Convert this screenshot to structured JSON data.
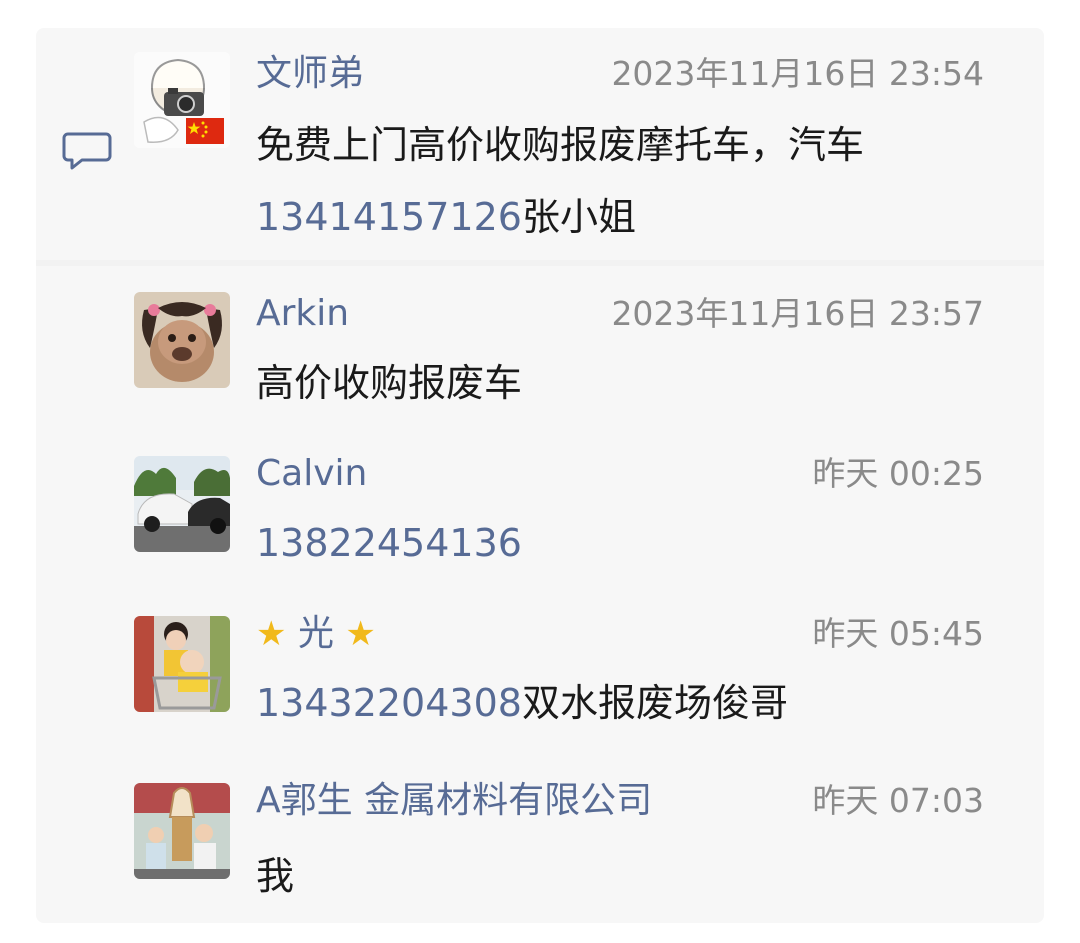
{
  "comments": [
    {
      "name": "文师弟",
      "time": "2023年11月16日 23:54",
      "text_line1": "免费上门高价收购报废摩托车，汽车",
      "phone": "13414157126",
      "text_suffix": "张小姐",
      "avatar": "avatar-chef-with-camera-and-china-flag"
    },
    {
      "name": "Arkin",
      "time": "2023年11月16日 23:57",
      "text": "高价收购报废车",
      "avatar": "avatar-dog-with-pigtails"
    },
    {
      "name": "Calvin",
      "time": "昨天 00:25",
      "phone": "13822454136",
      "avatar": "avatar-white-car"
    },
    {
      "name": "光",
      "name_decoration": "star-emoji",
      "time": "昨天 05:45",
      "phone": "13432204308",
      "text_suffix": "双水报废场俊哥",
      "avatar": "avatar-children-in-shopping-cart"
    },
    {
      "name": "A郭生 金属材料有限公司",
      "time": "昨天 07:03",
      "text": "我",
      "avatar": "avatar-children-with-ice-cream-statue"
    }
  ],
  "colors": {
    "name": "#576b95",
    "phone": "#576b95",
    "time": "#8a8a8a",
    "text": "#1a1a1a",
    "panel": "#f7f7f7"
  },
  "icons": {
    "comment": "comment-bubble-icon"
  }
}
